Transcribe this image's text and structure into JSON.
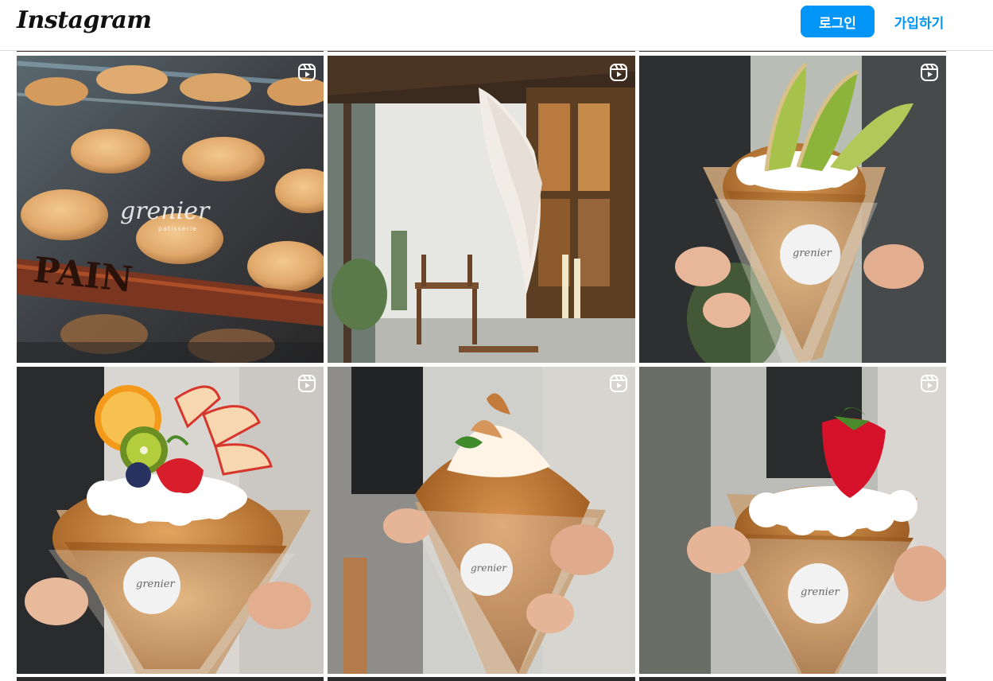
{
  "header": {
    "logo": "Instagram",
    "login_label": "로그인",
    "signup_label": "가입하기"
  },
  "colors": {
    "accent": "#0095f6"
  },
  "grid": {
    "reel_icon": "reels-icon",
    "posts": [
      {
        "name": "macaron-cookies-post",
        "type": "reel",
        "label": "grenier patisserie"
      },
      {
        "name": "cafe-interior-post",
        "type": "reel"
      },
      {
        "name": "melon-croissant-post",
        "type": "reel",
        "label": "grenier patisserie"
      },
      {
        "name": "fruit-croissant-post",
        "type": "reel",
        "label": "grenier patisserie"
      },
      {
        "name": "meringue-croissant-post",
        "type": "reel",
        "label": "grenier patisserie"
      },
      {
        "name": "strawberry-croissant-post",
        "type": "reel",
        "label": "grenier patisserie"
      }
    ]
  }
}
